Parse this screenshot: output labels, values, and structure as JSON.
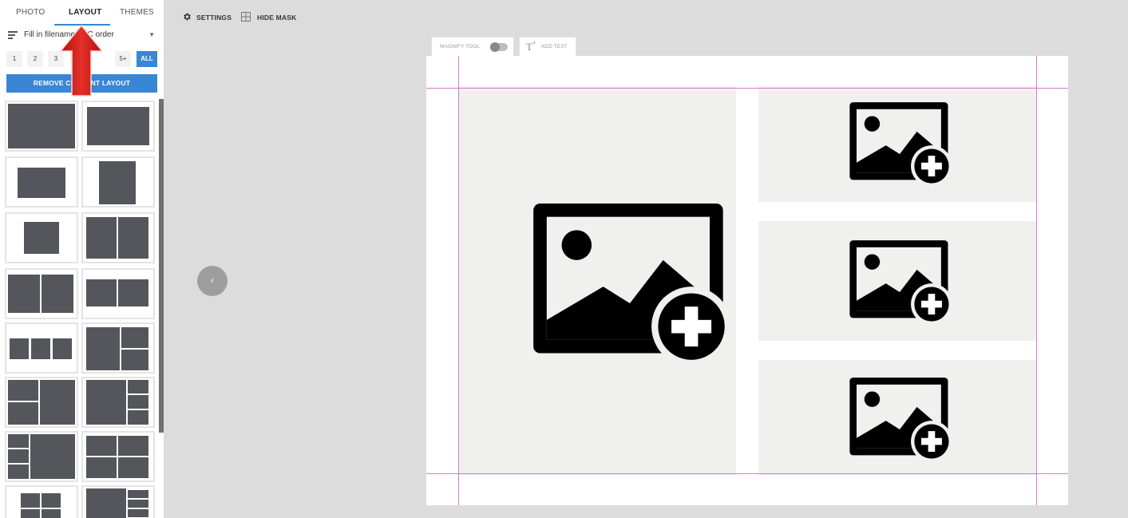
{
  "sidebar": {
    "tabs": [
      {
        "label": "PHOTO"
      },
      {
        "label": "LAYOUT"
      },
      {
        "label": "THEMES"
      }
    ],
    "active_tab": "LAYOUT",
    "sort": {
      "label": "Fill in filename ABC order"
    },
    "count_filters": [
      {
        "label": "1"
      },
      {
        "label": "2"
      },
      {
        "label": "3"
      },
      {
        "label": "4"
      },
      {
        "label": "5+"
      },
      {
        "label": "ALL"
      }
    ],
    "active_count": "ALL",
    "remove_button": "REMOVE CURRENT LAYOUT",
    "brand_color": "#3a86d4"
  },
  "toolbar": {
    "settings_label": "SETTINGS",
    "hide_mask_label": "HIDE MASK"
  },
  "canvas_toolbar": {
    "magnify_label": "MAGNIFY TOOL",
    "magnify_enabled": false,
    "add_text_label": "ADD TEXT"
  },
  "canvas": {
    "photo_slots": [
      {
        "name": "main-photo-slot",
        "icon": "add-photo-icon"
      },
      {
        "name": "right-top-photo-slot",
        "icon": "add-photo-icon"
      },
      {
        "name": "right-middle-photo-slot",
        "icon": "add-photo-icon"
      },
      {
        "name": "right-bottom-photo-slot",
        "icon": "add-photo-icon"
      }
    ],
    "guide_color": "#d27bd2"
  },
  "navigation": {
    "prev_glyph": "‹"
  },
  "annotation": {
    "arrow_color": "#d8231f"
  }
}
